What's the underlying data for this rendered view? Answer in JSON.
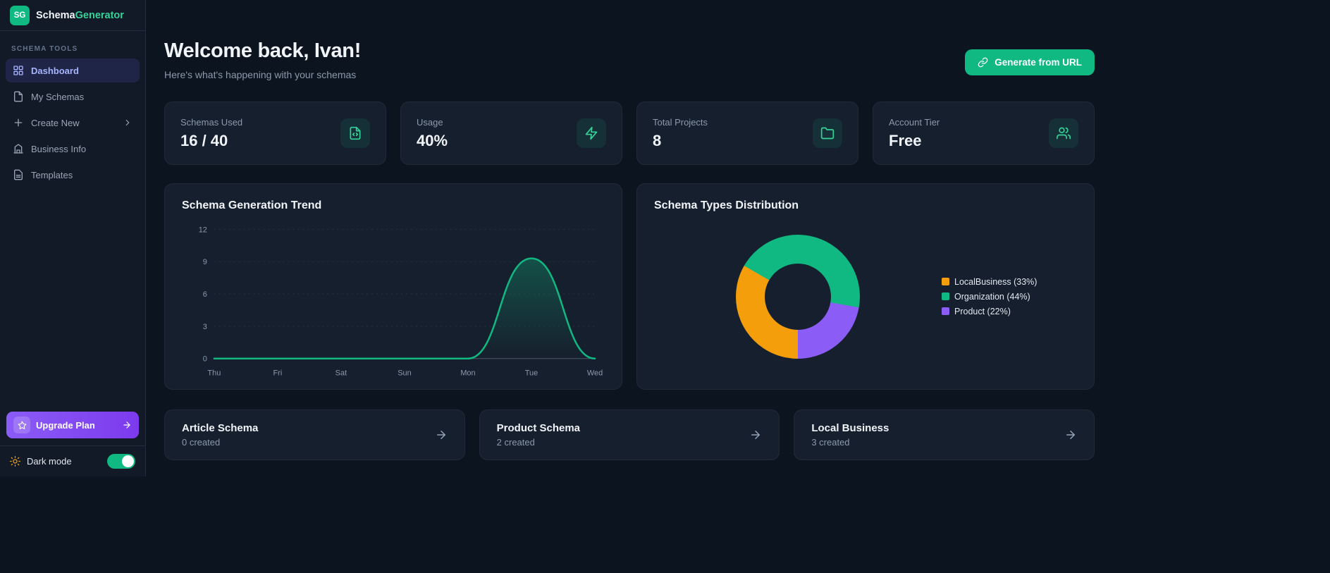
{
  "app": {
    "logo_initials": "SG",
    "name_primary": "Schema",
    "name_accent": "Generator"
  },
  "sidebar": {
    "section_label": "SCHEMA TOOLS",
    "items": [
      {
        "label": "Dashboard",
        "icon": "grid-icon",
        "active": true
      },
      {
        "label": "My Schemas",
        "icon": "file-icon",
        "active": false
      },
      {
        "label": "Create New",
        "icon": "plus-icon",
        "active": false,
        "has_chevron": true
      },
      {
        "label": "Business Info",
        "icon": "building-icon",
        "active": false
      },
      {
        "label": "Templates",
        "icon": "document-lines-icon",
        "active": false
      }
    ],
    "upgrade": {
      "label": "Upgrade Plan"
    },
    "dark_mode": {
      "label": "Dark mode",
      "enabled": true
    }
  },
  "header": {
    "title": "Welcome back, Ivan!",
    "subtitle": "Here's what's happening with your schemas",
    "action": {
      "label": "Generate from URL",
      "icon": "link-icon"
    }
  },
  "stats": [
    {
      "label": "Schemas Used",
      "value": "16 / 40",
      "icon": "file-code-icon"
    },
    {
      "label": "Usage",
      "value": "40%",
      "icon": "zap-icon"
    },
    {
      "label": "Total Projects",
      "value": "8",
      "icon": "folder-icon"
    },
    {
      "label": "Account Tier",
      "value": "Free",
      "icon": "users-icon"
    }
  ],
  "chart_data": [
    {
      "type": "area",
      "title": "Schema Generation Trend",
      "x": [
        "Thu",
        "Fri",
        "Sat",
        "Sun",
        "Mon",
        "Tue",
        "Wed"
      ],
      "values": [
        0,
        0,
        0,
        0,
        0,
        9.3,
        0
      ],
      "ylim": [
        0,
        12
      ],
      "yticks": [
        0,
        3,
        6,
        9,
        12
      ],
      "line_color": "#10b981",
      "grid": true,
      "legend_position": "none"
    },
    {
      "type": "pie",
      "donut": true,
      "title": "Schema Types Distribution",
      "slices": [
        {
          "label": "LocalBusiness",
          "pct": 33,
          "color": "#f59e0b"
        },
        {
          "label": "Organization",
          "pct": 44,
          "color": "#10b981"
        },
        {
          "label": "Product",
          "pct": 22,
          "color": "#8b5cf6"
        }
      ],
      "draw_order": [
        1,
        2,
        0
      ],
      "start_angle": 300,
      "legend_position": "right"
    }
  ],
  "quick_cards": [
    {
      "title": "Article Schema",
      "subtitle": "0 created"
    },
    {
      "title": "Product Schema",
      "subtitle": "2 created"
    },
    {
      "title": "Local Business",
      "subtitle": "3 created"
    }
  ],
  "colors": {
    "accent": "#10b981",
    "purple": "#8b5cf6",
    "orange": "#f59e0b",
    "active_nav": "#a5b4fc"
  }
}
